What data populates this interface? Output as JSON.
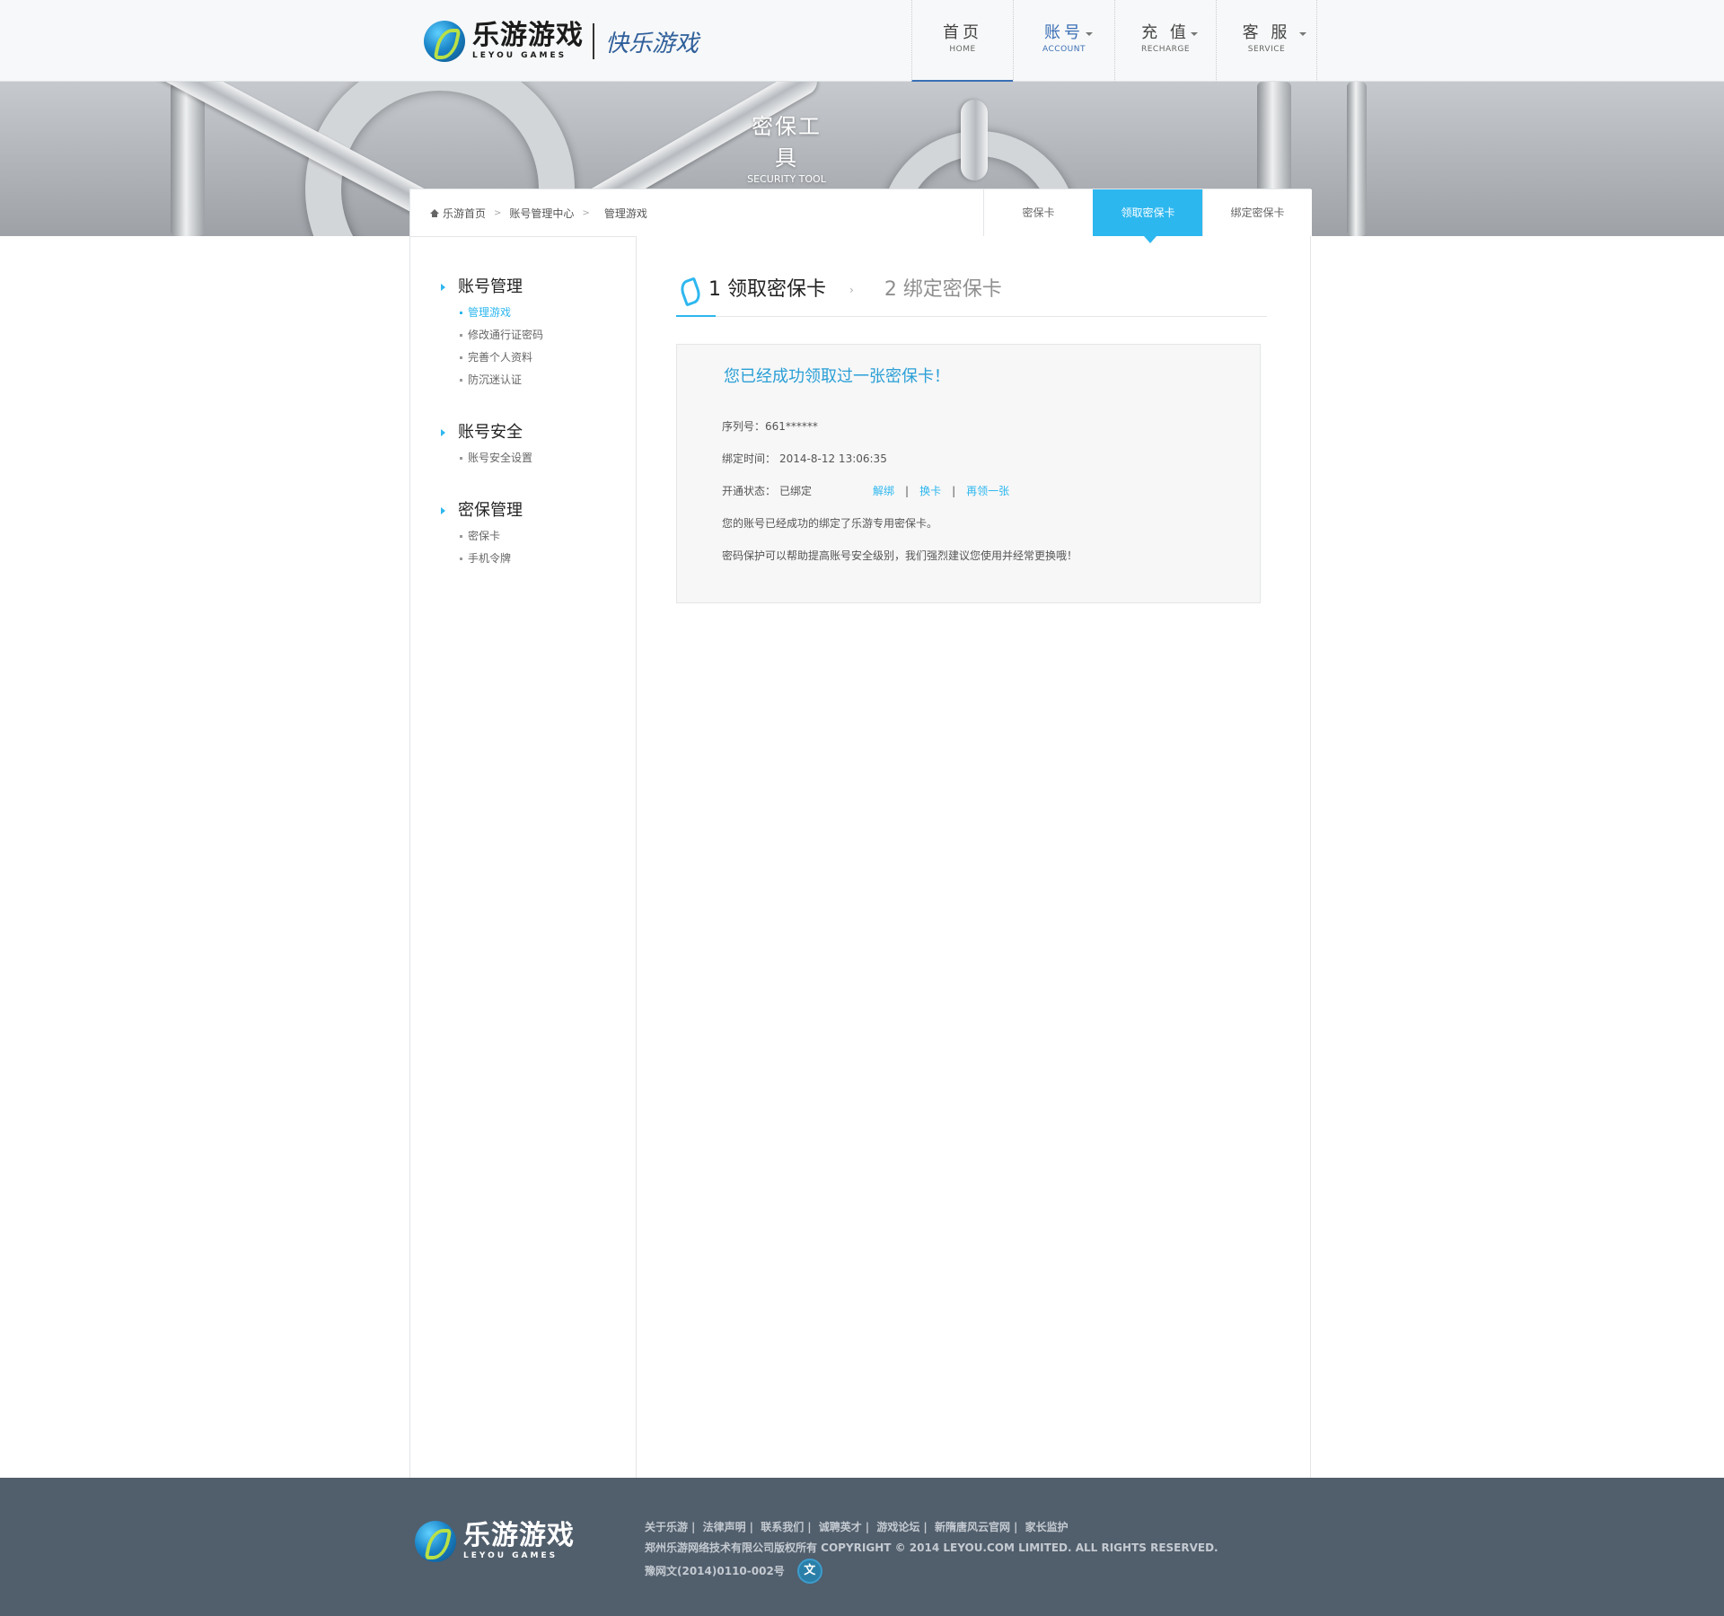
{
  "header": {
    "logo_cn": "乐游游戏",
    "logo_en": "LEYOU GAMES",
    "slogan": "快乐游戏",
    "nav": [
      {
        "cn": "首页",
        "en": "HOME"
      },
      {
        "cn": "账号",
        "en": "ACCOUNT"
      },
      {
        "cn": "充 值",
        "en": "RECHARGE"
      },
      {
        "cn": "客 服",
        "en": "SERVICE"
      }
    ]
  },
  "banner": {
    "title_cn": "密保工具",
    "title_en": "SECURITY TOOL"
  },
  "breadcrumb": [
    "乐游首页",
    "账号管理中心",
    "管理游戏"
  ],
  "top_tabs": [
    "密保卡",
    "领取密保卡",
    "绑定密保卡"
  ],
  "sidebar": [
    {
      "title": "账号管理",
      "links": [
        "管理游戏",
        "修改通行证密码",
        "完善个人资料",
        "防沉迷认证"
      ]
    },
    {
      "title": "账号安全",
      "links": [
        "账号安全设置"
      ]
    },
    {
      "title": "密保管理",
      "links": [
        "密保卡",
        "手机令牌"
      ]
    }
  ],
  "steps": {
    "step1": "1 领取密保卡",
    "step2": "2 绑定密保卡"
  },
  "result": {
    "title": "您已经成功领取过一张密保卡！",
    "serial_label": "序列号：",
    "serial_value": "661******",
    "bind_time_label": "绑定时间：",
    "bind_time_value": "2014-8-12 13:06:35",
    "status_label": "开通状态：",
    "status_value": "已绑定",
    "actions": [
      "解绑",
      "换卡",
      "再领一张"
    ],
    "note1": "您的账号已经成功的绑定了乐游专用密保卡。",
    "note2": "密码保护可以帮助提高账号安全级别，我们强烈建议您使用并经常更换哦！"
  },
  "footer": {
    "logo_cn": "乐游游戏",
    "logo_en": "LEYOU GAMES",
    "links": [
      "关于乐游",
      "法律声明",
      "联系我们",
      "诚聘英才",
      "游戏论坛",
      "新隋唐风云官网",
      "家长监护"
    ],
    "copyright": "郑州乐游网络技术有限公司版权所有 COPYRIGHT © 2014 LEYOU.COM LIMITED. ALL RIGHTS RESERVED.",
    "icp": "豫网文(2014)0110-002号",
    "badge_char": "文"
  },
  "colors": {
    "accent": "#2db7ef",
    "nav_blue": "#3a6fb5",
    "footer_bg": "#515e6c"
  }
}
